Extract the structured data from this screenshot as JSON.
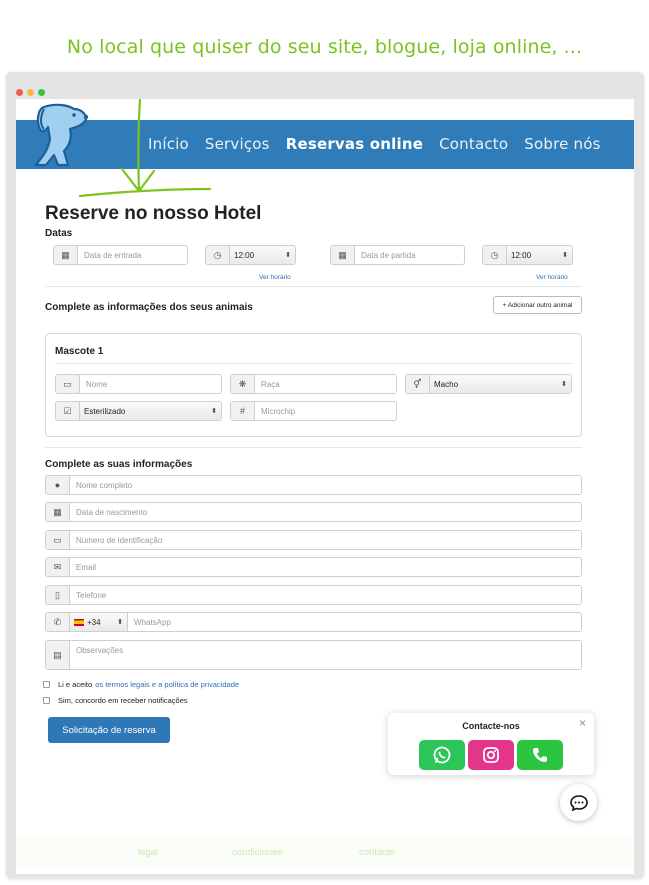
{
  "tagline": "No local que quiser do seu site, blogue, loja online, ...",
  "nav": {
    "items": [
      "Início",
      "Serviços",
      "Reservas online",
      "Contacto",
      "Sobre nós"
    ],
    "active_index": 2
  },
  "page": {
    "title": "Reserve no nosso Hotel",
    "dates_label": "Datas",
    "checkin_placeholder": "Data de entrada",
    "checkin_time": "12:00",
    "checkout_placeholder": "Data de partida",
    "checkout_time": "12:00",
    "view_schedule_1": "Ver horário",
    "view_schedule_2": "Ver horário"
  },
  "pets": {
    "section_title": "Complete as informações dos seus animais",
    "add_button": "+ Adicionar outro animal",
    "pet_title": "Mascote 1",
    "name_placeholder": "Nome",
    "breed_placeholder": "Raça",
    "sex_value": "Macho",
    "sterilized_value": "Esterilizado",
    "microchip_placeholder": "Microchip"
  },
  "owner": {
    "section_title": "Complete as suas informações",
    "fullname_placeholder": "Nome completo",
    "birthdate_placeholder": "Data de nascimento",
    "id_placeholder": "Número de identificação",
    "email_placeholder": "Email",
    "phone_placeholder": "Telefone",
    "country_code": "+34",
    "whatsapp_placeholder": "WhatsApp",
    "notes_placeholder": "Observações"
  },
  "consent": {
    "terms_prefix": "Li e aceito",
    "terms_link": "os termos legais e a política de privacidade",
    "notifications": "Sim, concordo em receber notificações"
  },
  "submit_label": "Solicitação de reserva",
  "contact": {
    "title": "Contacte-nos",
    "close": "×"
  },
  "footer": {
    "links": [
      "legal",
      "condiciones",
      "contacto"
    ]
  },
  "colors": {
    "brand_blue": "#2f7cb9",
    "tagline_green": "#7bc31e",
    "whatsapp": "#2dc65a",
    "instagram": "#e33589",
    "phone": "#2bc540"
  }
}
